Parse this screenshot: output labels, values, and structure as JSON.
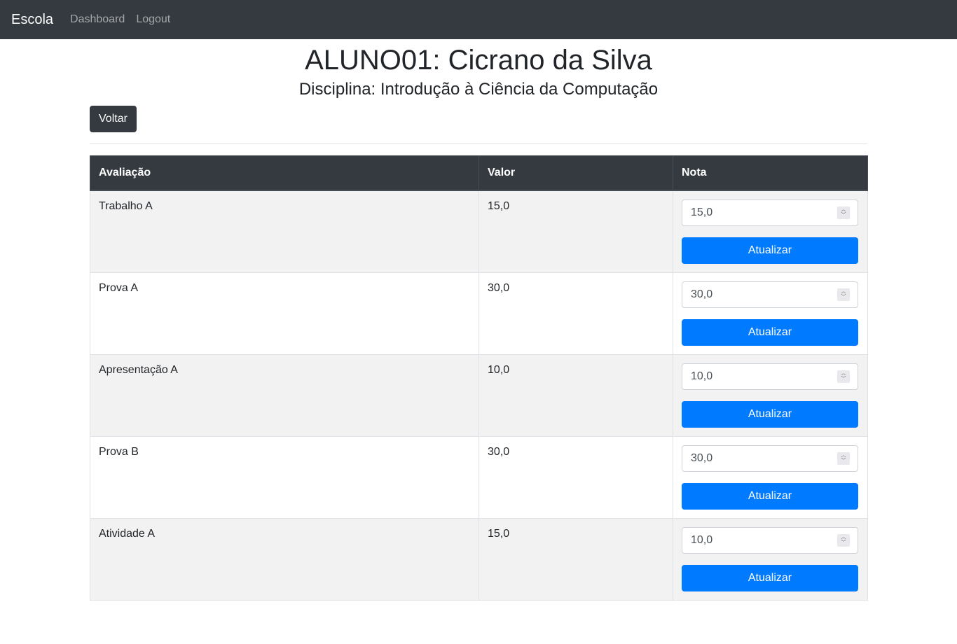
{
  "navbar": {
    "brand": "Escola",
    "links": [
      "Dashboard",
      "Logout"
    ]
  },
  "header": {
    "title": "ALUNO01: Cicrano da Silva",
    "subtitle": "Disciplina: Introdução à Ciência da Computação"
  },
  "actions": {
    "back_label": "Voltar"
  },
  "table": {
    "columns": [
      "Avaliação",
      "Valor",
      "Nota"
    ],
    "update_label": "Atualizar",
    "rows": [
      {
        "avaliacao": "Trabalho A",
        "valor": "15,0",
        "nota": "15,0"
      },
      {
        "avaliacao": "Prova A",
        "valor": "30,0",
        "nota": "30,0"
      },
      {
        "avaliacao": "Apresentação A",
        "valor": "10,0",
        "nota": "10,0"
      },
      {
        "avaliacao": "Prova B",
        "valor": "30,0",
        "nota": "30,0"
      },
      {
        "avaliacao": "Atividade A",
        "valor": "15,0",
        "nota": "10,0"
      }
    ]
  },
  "colors": {
    "navbar": "#343a40",
    "primary": "#007bff",
    "stripe": "#f2f2f2"
  }
}
